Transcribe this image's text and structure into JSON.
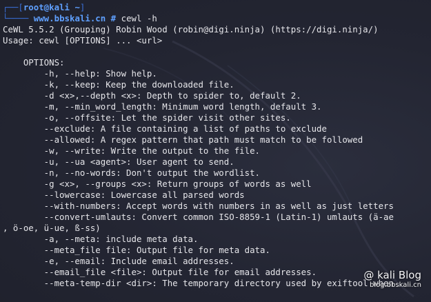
{
  "prompt": {
    "user_host": "root@kali",
    "path": "~",
    "site": "www.bbskali.cn",
    "hash": "#",
    "command": "cewl -h"
  },
  "output": [
    "CeWL 5.5.2 (Grouping) Robin Wood (robin@digi.ninja) (https://digi.ninja/)",
    "Usage: cewl [OPTIONS] ... <url>",
    "",
    "    OPTIONS:",
    "        -h, --help: Show help.",
    "        -k, --keep: Keep the downloaded file.",
    "        -d <x>,--depth <x>: Depth to spider to, default 2.",
    "        -m, --min_word_length: Minimum word length, default 3.",
    "        -o, --offsite: Let the spider visit other sites.",
    "        --exclude: A file containing a list of paths to exclude",
    "        --allowed: A regex pattern that path must match to be followed",
    "        -w, --write: Write the output to the file.",
    "        -u, --ua <agent>: User agent to send.",
    "        -n, --no-words: Don't output the wordlist.",
    "        -g <x>, --groups <x>: Return groups of words as well",
    "        --lowercase: Lowercase all parsed words",
    "        --with-numbers: Accept words with numbers in as well as just letters",
    "        --convert-umlauts: Convert common ISO-8859-1 (Latin-1) umlauts (ä-ae",
    ", ö-oe, ü-ue, ß-ss)",
    "        -a, --meta: include meta data.",
    "        --meta_file file: Output file for meta data.",
    "        -e, --email: Include email addresses.",
    "        --email_file <file>: Output file for email addresses.",
    "        --meta-temp-dir <dir>: The temporary directory used by exiftool when"
  ],
  "watermark": {
    "title": "@ kali Blog",
    "subtitle": "blog.bbskali.cn"
  },
  "colors": {
    "background": "#222431",
    "prompt_blue": "#3a6fd8",
    "prompt_bright_blue": "#5fa0ff",
    "text": "#e6e6ea"
  }
}
